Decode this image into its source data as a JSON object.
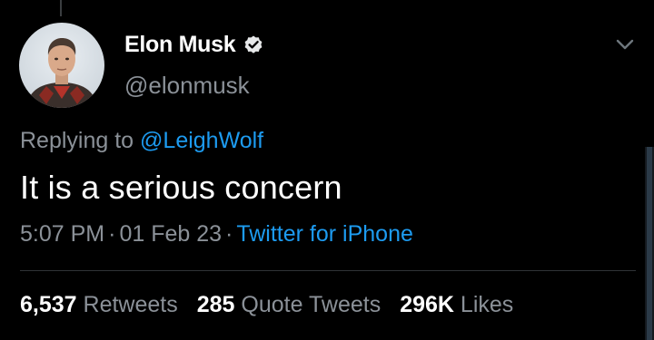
{
  "tweet": {
    "author": {
      "display_name": "Elon Musk",
      "handle": "@elonmusk",
      "verified": true
    },
    "reply": {
      "prefix": "Replying to",
      "to_handle": "@LeighWolf"
    },
    "text": "It is a serious concern",
    "time": "5:07 PM",
    "date": "01 Feb 23",
    "source": "Twitter for iPhone",
    "separator": "·",
    "stats": {
      "retweets": {
        "count": "6,537",
        "label": "Retweets"
      },
      "quote_tweets": {
        "count": "285",
        "label": "Quote Tweets"
      },
      "likes": {
        "count": "296K",
        "label": "Likes"
      }
    }
  },
  "icons": {
    "verified": "verified-badge-icon",
    "more": "chevron-down-icon"
  },
  "colors": {
    "background": "#000000",
    "primary_text": "#ffffff",
    "secondary_text": "#8b9198",
    "accent": "#1d9bf0",
    "divider": "#2f3336"
  }
}
